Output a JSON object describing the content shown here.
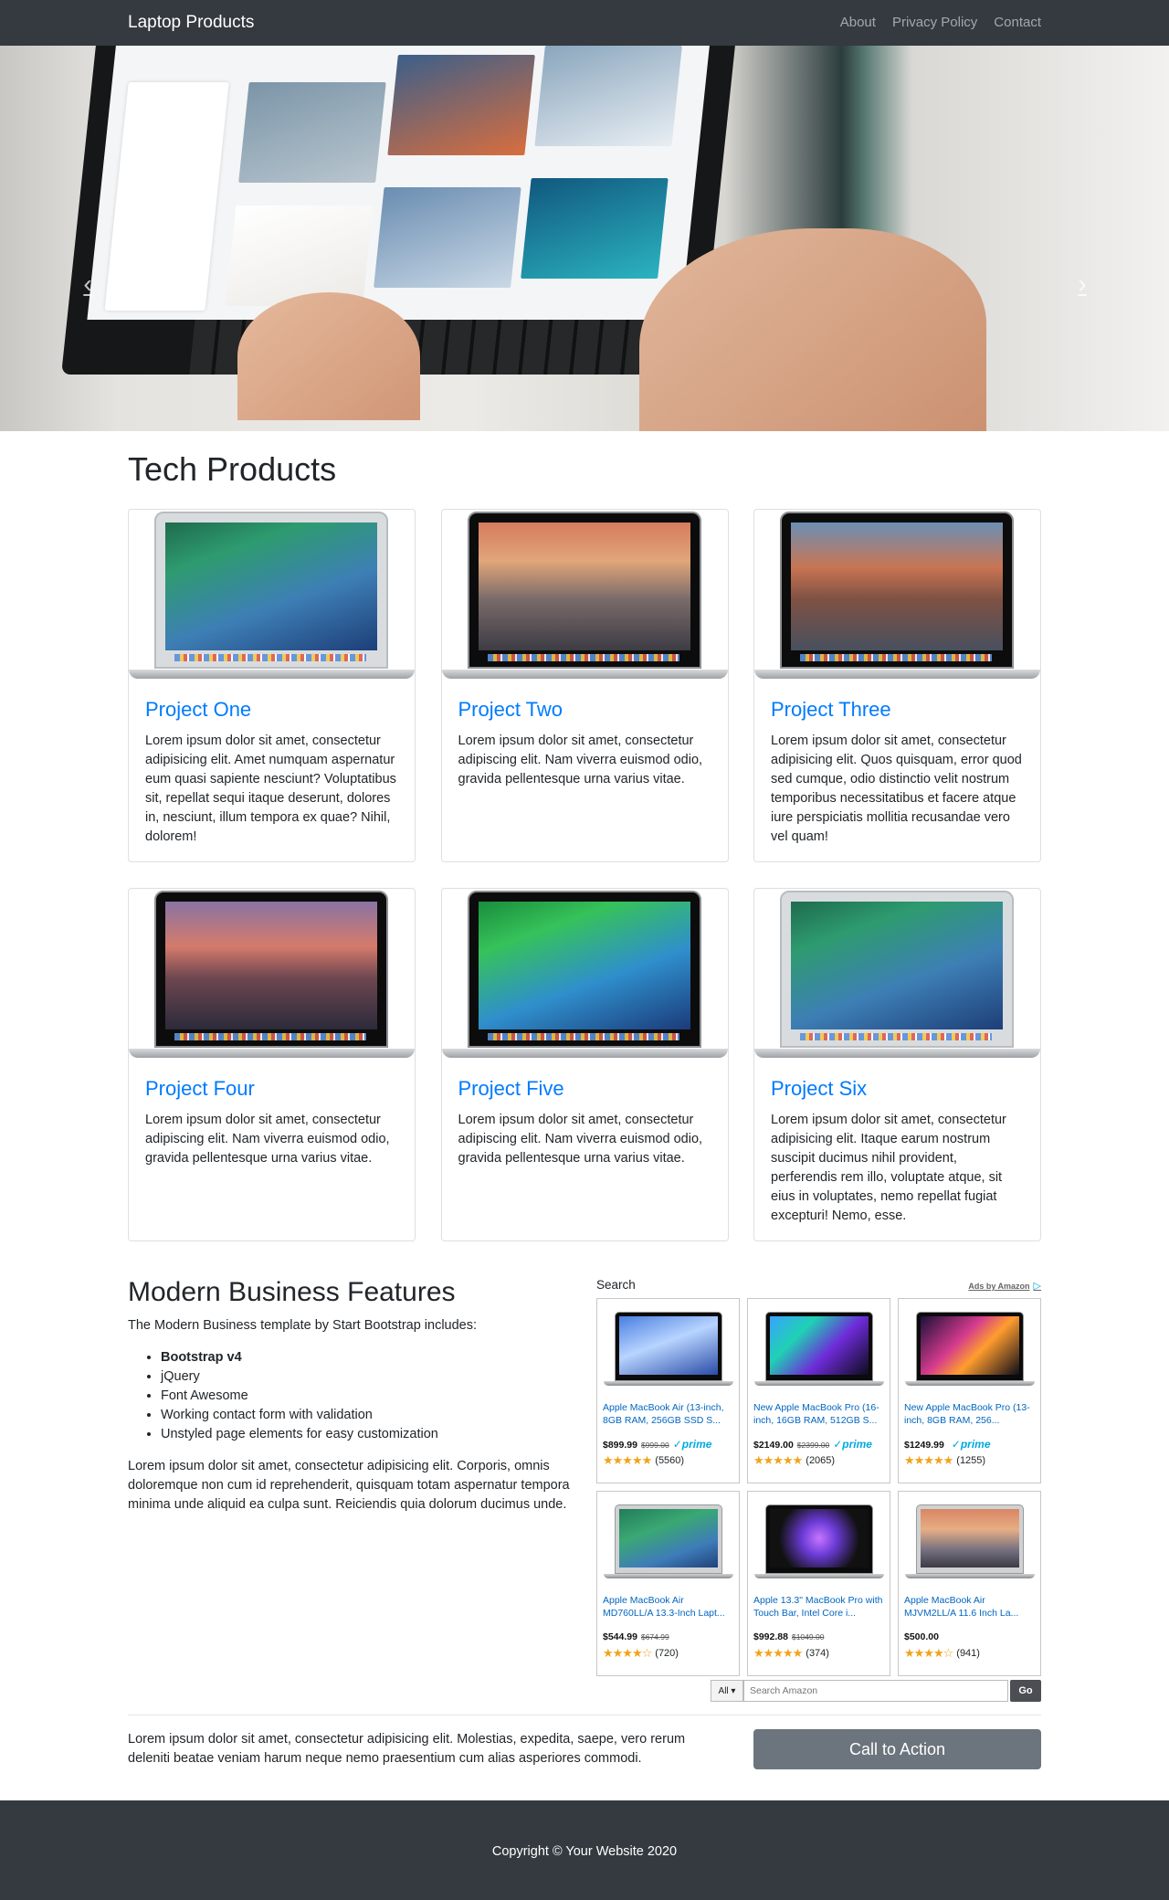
{
  "navbar": {
    "brand": "Laptop Products",
    "links": [
      "About",
      "Privacy Policy",
      "Contact"
    ]
  },
  "carousel": {
    "prev_icon": "chevron-left-icon",
    "next_icon": "chevron-right-icon",
    "prev_glyph": "‹",
    "next_glyph": "›",
    "slides": 3,
    "active_slide": 1
  },
  "products": {
    "heading": "Tech Products",
    "items": [
      {
        "title": "Project One",
        "text": "Lorem ipsum dolor sit amet, consectetur adipisicing elit. Amet numquam aspernatur eum quasi sapiente nesciunt? Voluptatibus sit, repellat sequi itaque deserunt, dolores in, nesciunt, illum tempora ex quae? Nihil, dolorem!"
      },
      {
        "title": "Project Two",
        "text": "Lorem ipsum dolor sit amet, consectetur adipiscing elit. Nam viverra euismod odio, gravida pellentesque urna varius vitae."
      },
      {
        "title": "Project Three",
        "text": "Lorem ipsum dolor sit amet, consectetur adipisicing elit. Quos quisquam, error quod sed cumque, odio distinctio velit nostrum temporibus necessitatibus et facere atque iure perspiciatis mollitia recusandae vero vel quam!"
      },
      {
        "title": "Project Four",
        "text": "Lorem ipsum dolor sit amet, consectetur adipiscing elit. Nam viverra euismod odio, gravida pellentesque urna varius vitae."
      },
      {
        "title": "Project Five",
        "text": "Lorem ipsum dolor sit amet, consectetur adipiscing elit. Nam viverra euismod odio, gravida pellentesque urna varius vitae."
      },
      {
        "title": "Project Six",
        "text": "Lorem ipsum dolor sit amet, consectetur adipisicing elit. Itaque earum nostrum suscipit ducimus nihil provident, perferendis rem illo, voluptate atque, sit eius in voluptates, nemo repellat fugiat excepturi! Nemo, esse."
      }
    ]
  },
  "features": {
    "heading": "Modern Business Features",
    "intro": "The Modern Business template by Start Bootstrap includes:",
    "list": [
      "Bootstrap v4",
      "jQuery",
      "Font Awesome",
      "Working contact form with validation",
      "Unstyled page elements for easy customization"
    ],
    "body": "Lorem ipsum dolor sit amet, consectetur adipisicing elit. Corporis, omnis doloremque non cum id reprehenderit, quisquam totam aspernatur tempora minima unde aliquid ea culpa sunt. Reiciendis quia dolorum ducimus unde."
  },
  "ads": {
    "title": "Search",
    "ads_by": "Ads by Amazon",
    "items": [
      {
        "title": "Apple MacBook Air (13-inch, 8GB RAM, 256GB SSD S...",
        "price": "$899.99",
        "old_price": "$999.00",
        "prime": "✓prime",
        "stars": "★★★★★",
        "reviews": "(5560)"
      },
      {
        "title": "New Apple MacBook Pro (16-inch, 16GB RAM, 512GB S...",
        "price": "$2149.00",
        "old_price": "$2399.00",
        "prime": "✓prime",
        "stars": "★★★★★",
        "reviews": "(2065)"
      },
      {
        "title": "New Apple MacBook Pro (13-inch, 8GB RAM, 256...",
        "price": "$1249.99",
        "old_price": "",
        "prime": "✓prime",
        "stars": "★★★★★",
        "reviews": "(1255)"
      },
      {
        "title": "Apple MacBook Air MD760LL/A 13.3-Inch Lapt...",
        "price": "$544.99",
        "old_price": "$674.99",
        "prime": "",
        "stars": "★★★★☆",
        "reviews": "(720)"
      },
      {
        "title": "Apple 13.3\" MacBook Pro with Touch Bar, Intel Core i...",
        "price": "$992.88",
        "old_price": "$1049.00",
        "prime": "",
        "stars": "★★★★★",
        "reviews": "(374)"
      },
      {
        "title": "Apple MacBook Air MJVM2LL/A 11.6 Inch La...",
        "price": "$500.00",
        "old_price": "",
        "prime": "",
        "stars": "★★★★☆",
        "reviews": "(941)"
      }
    ],
    "search": {
      "category": "All ▾",
      "placeholder": "Search Amazon",
      "button": "Go"
    }
  },
  "cta": {
    "text": "Lorem ipsum dolor sit amet, consectetur adipisicing elit. Molestias, expedita, saepe, vero rerum deleniti beatae veniam harum neque nemo praesentium cum alias asperiores commodi.",
    "button": "Call to Action"
  },
  "footer": {
    "copyright": "Copyright © Your Website 2020"
  },
  "colors": {
    "navbar": "#343a40",
    "link": "#007bff",
    "cta_button": "#6c757d",
    "amazon_link": "#0066c0",
    "prime": "#00a8e1",
    "star": "#f0a31a"
  }
}
